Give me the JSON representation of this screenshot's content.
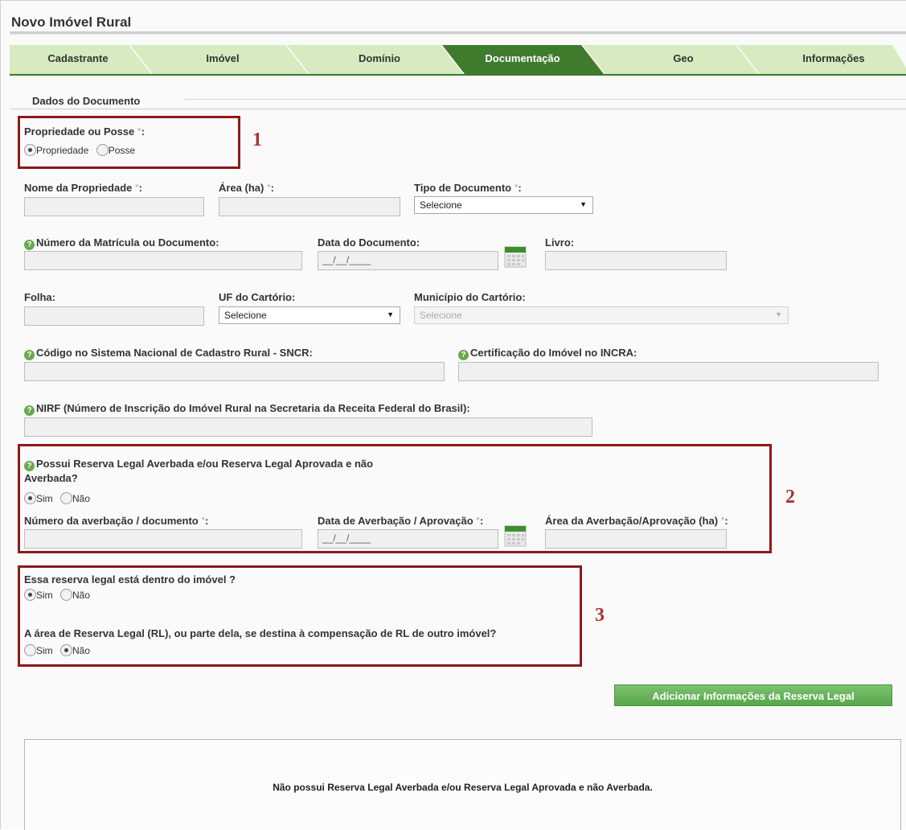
{
  "window": {
    "title": "Novo Imóvel Rural"
  },
  "tabs": [
    {
      "label": "Cadastrante",
      "active": false
    },
    {
      "label": "Imóvel",
      "active": false
    },
    {
      "label": "Domínio",
      "active": false
    },
    {
      "label": "Documentação",
      "active": true
    },
    {
      "label": "Geo",
      "active": false
    },
    {
      "label": "Informações",
      "active": false
    }
  ],
  "colors": {
    "tab_inactive": "#d6ebc0",
    "tab_active": "#3e7b2c",
    "highlight_box": "#8b1a1a",
    "button": "#62ad55"
  },
  "section": {
    "title": "Dados do Documento"
  },
  "required_mark": "*",
  "propriedade_posse": {
    "label": "Propriedade ou Posse",
    "options": [
      {
        "label": "Propriedade",
        "selected": true
      },
      {
        "label": "Posse",
        "selected": false
      }
    ]
  },
  "fields": {
    "nome_propriedade": {
      "label": "Nome da Propriedade",
      "value": ""
    },
    "area_ha": {
      "label": "Área (ha)",
      "value": ""
    },
    "tipo_documento": {
      "label": "Tipo de Documento",
      "value": "Selecione"
    },
    "numero_matricula": {
      "label": "Número da Matrícula ou Documento:",
      "value": ""
    },
    "data_documento": {
      "label": "Data do Documento:",
      "placeholder": "__/__/____"
    },
    "livro": {
      "label": "Livro:",
      "value": ""
    },
    "folha": {
      "label": "Folha:",
      "value": ""
    },
    "uf_cartorio": {
      "label": "UF do Cartório:",
      "value": "Selecione"
    },
    "municipio_cartorio": {
      "label": "Município do Cartório:",
      "value": "Selecione"
    },
    "codigo_sncr": {
      "label": "Código no Sistema Nacional de Cadastro Rural - SNCR:",
      "value": ""
    },
    "certificacao_incra": {
      "label": "Certificação do Imóvel no INCRA:",
      "value": ""
    },
    "nirf": {
      "label": "NIRF (Número de Inscrição do Imóvel Rural na Secretaria da Receita Federal do Brasil):",
      "value": ""
    }
  },
  "reserva_legal": {
    "question_line1": "Possui Reserva Legal Averbada e/ou Reserva Legal Aprovada e não",
    "question_line2": "Averbada?",
    "options": [
      {
        "label": "Sim",
        "selected": true
      },
      {
        "label": "Não",
        "selected": false
      }
    ],
    "numero_averbacao": {
      "label": "Número da averbação / documento",
      "value": ""
    },
    "data_averbacao": {
      "label": "Data de Averbação / Aprovação",
      "placeholder": "__/__/____"
    },
    "area_averbacao": {
      "label": "Área da Averbação/Aprovação (ha)",
      "value": ""
    }
  },
  "dentro_imovel": {
    "question": "Essa reserva legal está dentro do imóvel ?",
    "options": [
      {
        "label": "Sim",
        "selected": true
      },
      {
        "label": "Não",
        "selected": false
      }
    ]
  },
  "compensacao": {
    "question": "A área de Reserva Legal (RL), ou parte dela, se destina à compensação de RL de outro imóvel?",
    "options": [
      {
        "label": "Sim",
        "selected": false
      },
      {
        "label": "Não",
        "selected": true
      }
    ]
  },
  "annotations": [
    "1",
    "2",
    "3"
  ],
  "add_button": {
    "label": "Adicionar Informações da Reserva Legal"
  },
  "empty_message": "Não possui Reserva Legal Averbada e/ou Reserva Legal Aprovada e não Averbada."
}
